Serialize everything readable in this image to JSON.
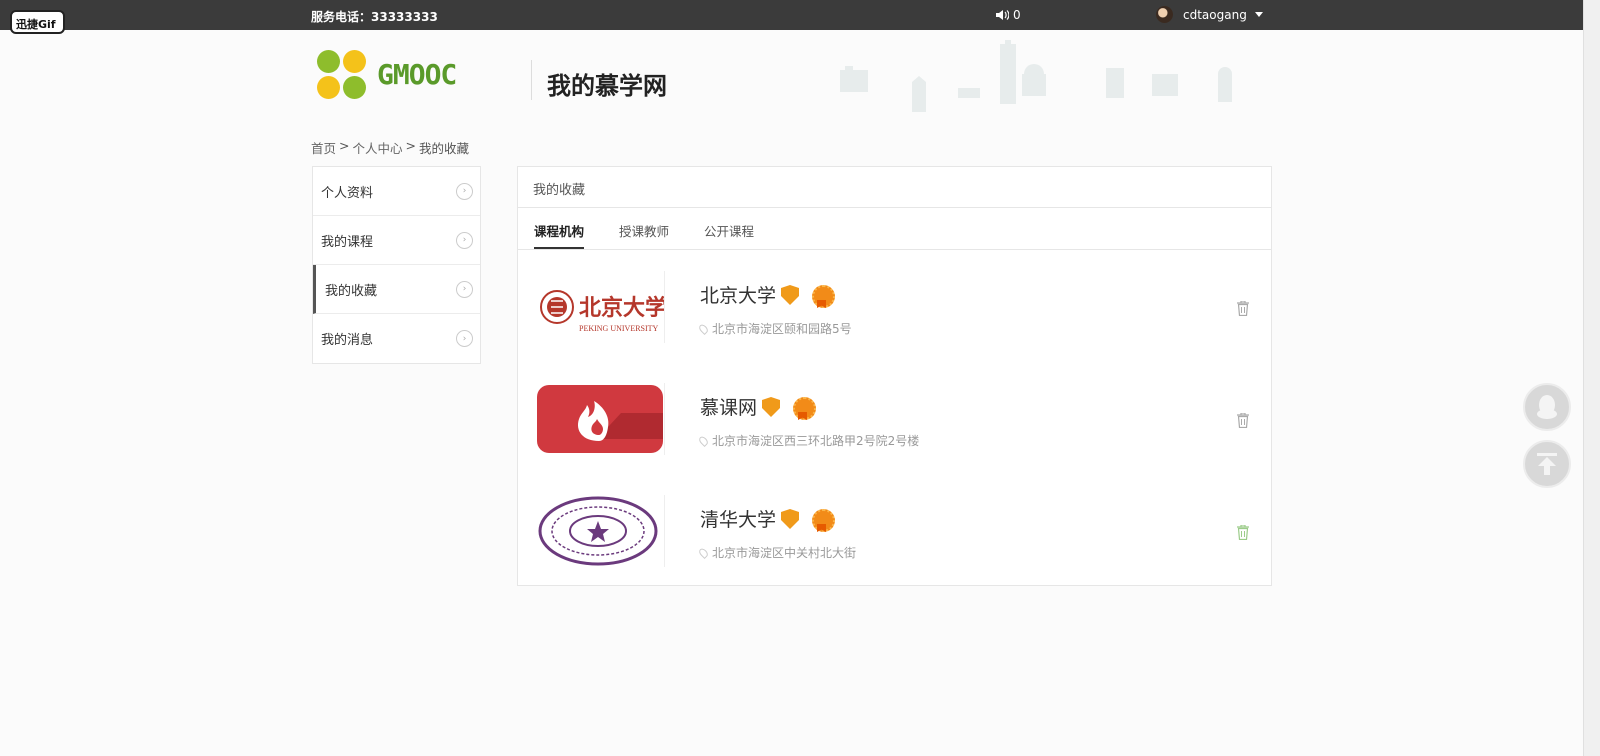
{
  "topbar": {
    "gif_badge": "迅捷Gif",
    "phone": "服务电话：33333333",
    "sound_count": "0",
    "username": "cdtaogang"
  },
  "header": {
    "brand": "GMOOC",
    "site_title": "我的慕学网"
  },
  "breadcrumb": {
    "items": [
      "首页",
      "个人中心",
      "我的收藏"
    ],
    "separator": ">"
  },
  "sidebar": {
    "items": [
      {
        "label": "个人资料"
      },
      {
        "label": "我的课程"
      },
      {
        "label": "我的收藏"
      },
      {
        "label": "我的消息"
      }
    ],
    "active_index": 2
  },
  "panel": {
    "title": "我的收藏",
    "tabs": [
      "课程机构",
      "授课教师",
      "公开课程"
    ],
    "active_tab": 0,
    "orgs": [
      {
        "name": "北京大学",
        "address": "北京市海淀区颐和园路5号",
        "logo_text": "北京大学",
        "logo_sub": "PEKING UNIVERSITY"
      },
      {
        "name": "慕课网",
        "address": "北京市海淀区西三环北路甲2号院2号楼"
      },
      {
        "name": "清华大学",
        "address": "北京市海淀区中关村北大街"
      }
    ]
  },
  "colors": {
    "topbar_bg": "#3b3b3b",
    "brand_green": "#5a9a2a",
    "badge_orange": "#f09a1a",
    "pku_red": "#b5372b",
    "imooc_red": "#d0393f",
    "tsinghua_purple": "#6b3a7d"
  },
  "icons": {
    "sound": "speaker-icon",
    "trash": "trash-icon",
    "qq": "qq-penguin-icon",
    "back_to_top": "arrow-up-icon"
  }
}
